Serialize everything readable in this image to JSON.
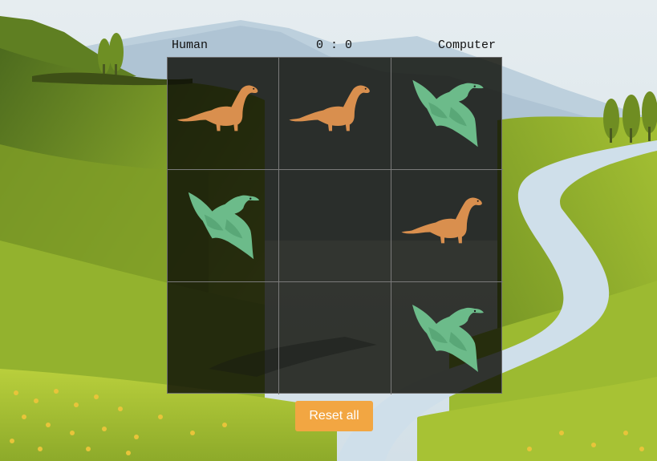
{
  "scoreboard": {
    "human_label": "Human",
    "score": "0 : 0",
    "computer_label": "Computer"
  },
  "board": {
    "cells": [
      "brontosaurus",
      "brontosaurus",
      "pterodactyl",
      "pterodactyl",
      "",
      "brontosaurus",
      "",
      "",
      "pterodactyl"
    ]
  },
  "colors": {
    "brontosaurus": "#d98f4e",
    "pterodactyl": "#6cbb8a",
    "reset_button": "#f2a642",
    "sky": "#dfe8ee",
    "grass": "#a9c23a",
    "river": "#c9dbe8"
  },
  "controls": {
    "reset_label": "Reset all"
  }
}
